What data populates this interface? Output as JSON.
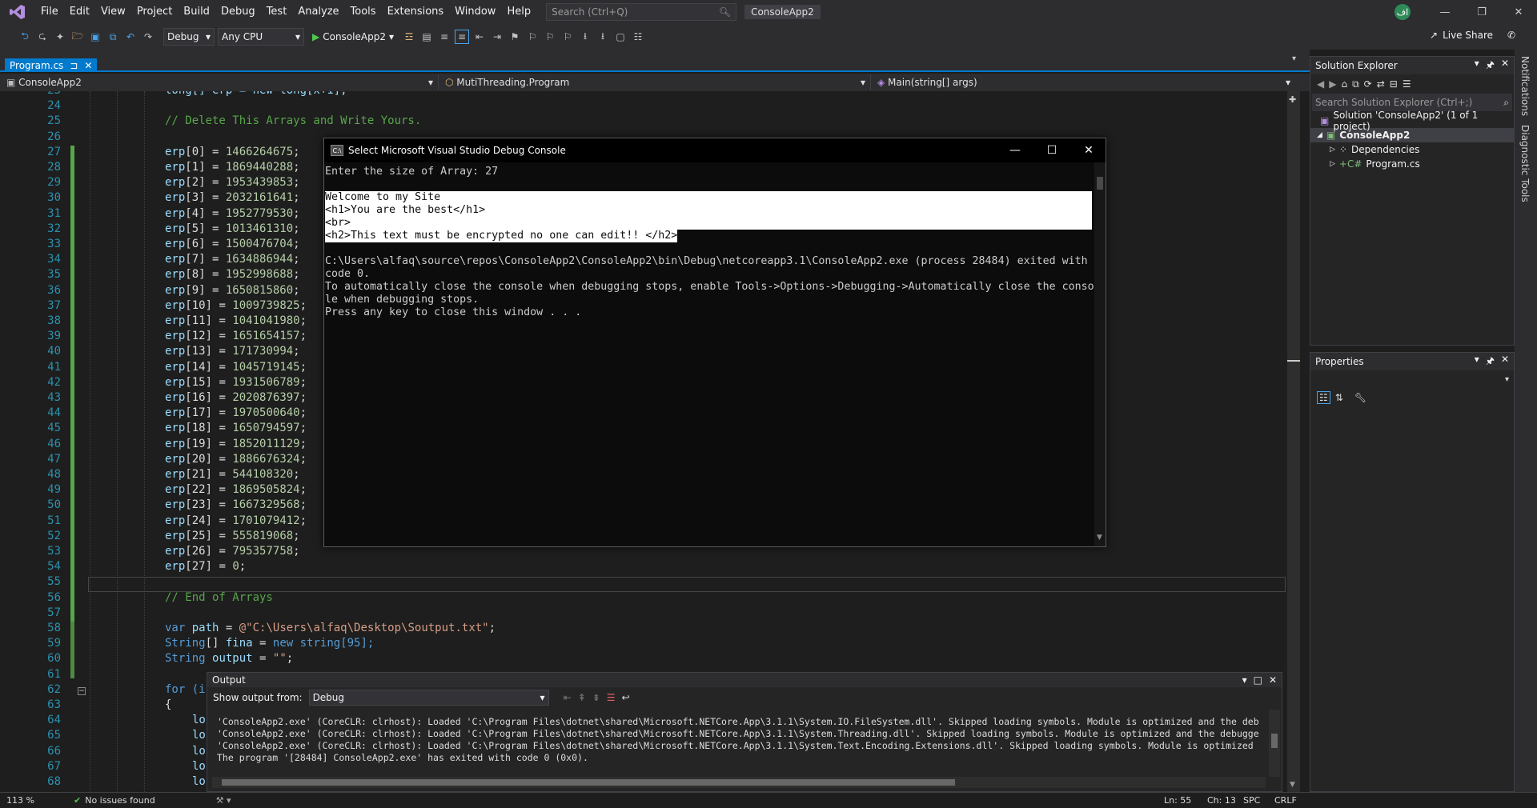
{
  "menubar": {
    "items": [
      "File",
      "Edit",
      "View",
      "Project",
      "Build",
      "Debug",
      "Test",
      "Analyze",
      "Tools",
      "Extensions",
      "Window",
      "Help"
    ],
    "search_placeholder": "Search (Ctrl+Q)",
    "solution_name": "ConsoleApp2",
    "avatar_initials": "اف"
  },
  "toolbar": {
    "config": "Debug",
    "platform": "Any CPU",
    "run_target": "ConsoleApp2",
    "live_share": "Live Share"
  },
  "tabs": {
    "active": "Program.cs",
    "pin_glyph": "⊐"
  },
  "navbar": {
    "project": "ConsoleApp2",
    "type": "MutiThreading.Program",
    "member": "Main(string[] args)"
  },
  "editor": {
    "line_numbers": [
      "23",
      "24",
      "25",
      "26",
      "27",
      "28",
      "29",
      "30",
      "31",
      "32",
      "33",
      "34",
      "35",
      "36",
      "37",
      "38",
      "39",
      "40",
      "41",
      "42",
      "43",
      "44",
      "45",
      "46",
      "47",
      "48",
      "49",
      "50",
      "51",
      "52",
      "53",
      "54",
      "55",
      "56",
      "57",
      "58",
      "59",
      "60",
      "61",
      "62",
      "63",
      "64",
      "65",
      "66",
      "67",
      "68"
    ],
    "line_23": "long[] erp = new long[x+1];",
    "line_25": "// Delete This Arrays and Write Yours.",
    "array_values": [
      "1466264675",
      "1869440288",
      "1953439853",
      "2032161641",
      "1952779530",
      "1013461310",
      "1500476704",
      "1634886944",
      "1952998688",
      "1650815860",
      "1009739825",
      "1041041980",
      "1651654157",
      "171730994",
      "1045719145",
      "1931506789",
      "2020876397",
      "1970500640",
      "1650794597",
      "1852011129",
      "1886676324",
      "544108320",
      "1869505824",
      "1667329568",
      "1701079412",
      "555819068",
      "795357758",
      "0"
    ],
    "line_56": "// End of Arrays",
    "line_58_kw": "var",
    "line_58_var": "path",
    "line_58_str": "@\"C:\\Users\\alfaq\\Desktop\\Soutput.txt\"",
    "line_59_type": "String",
    "line_59_var": "fina",
    "line_59_rest": "string[95];",
    "line_60_type": "String",
    "line_60_var": "output",
    "line_60_str": "\"\"",
    "line_62": "for (i",
    "line_63": "{",
    "line_lo": "lo"
  },
  "debug_console": {
    "title": "Select Microsoft Visual Studio Debug Console",
    "lines": [
      "Enter the size of Array: 27",
      "",
      "Welcome to my Site",
      "<h1>You are the best</h1>",
      "<br>",
      "<h2>This text must be encrypted no one can edit!! </h2>",
      "",
      "C:\\Users\\alfaq\\source\\repos\\ConsoleApp2\\ConsoleApp2\\bin\\Debug\\netcoreapp3.1\\ConsoleApp2.exe (process 28484) exited with",
      "code 0.",
      "To automatically close the console when debugging stops, enable Tools->Options->Debugging->Automatically close the conso",
      "le when debugging stops.",
      "Press any key to close this window . . ."
    ]
  },
  "solution_explorer": {
    "title": "Solution Explorer",
    "search_placeholder": "Search Solution Explorer (Ctrl+;)",
    "solution": "Solution 'ConsoleApp2' (1 of 1 project)",
    "project": "ConsoleApp2",
    "dependencies": "Dependencies",
    "file": "Program.cs"
  },
  "properties": {
    "title": "Properties"
  },
  "side_tabs": {
    "notifications": "Notifications",
    "diagnostic": "Diagnostic Tools"
  },
  "output": {
    "title": "Output",
    "show_from_label": "Show output from:",
    "source": "Debug",
    "lines": [
      "'ConsoleApp2.exe' (CoreCLR: clrhost): Loaded 'C:\\Program Files\\dotnet\\shared\\Microsoft.NETCore.App\\3.1.1\\System.IO.FileSystem.dll'. Skipped loading symbols. Module is optimized and the deb",
      "'ConsoleApp2.exe' (CoreCLR: clrhost): Loaded 'C:\\Program Files\\dotnet\\shared\\Microsoft.NETCore.App\\3.1.1\\System.Threading.dll'. Skipped loading symbols. Module is optimized and the debugge",
      "'ConsoleApp2.exe' (CoreCLR: clrhost): Loaded 'C:\\Program Files\\dotnet\\shared\\Microsoft.NETCore.App\\3.1.1\\System.Text.Encoding.Extensions.dll'. Skipped loading symbols. Module is optimized",
      "The program '[28484] ConsoleApp2.exe' has exited with code 0 (0x0)."
    ]
  },
  "statusbar": {
    "zoom": "113 %",
    "issues": "No issues found",
    "ln": "Ln: 55",
    "ch": "Ch: 13",
    "spc": "SPC",
    "crlf": "CRLF"
  },
  "colors": {
    "accent": "#007acc",
    "comment": "#57a64a",
    "keyword": "#569cd6",
    "number": "#b5cea8",
    "string": "#d69d85"
  }
}
